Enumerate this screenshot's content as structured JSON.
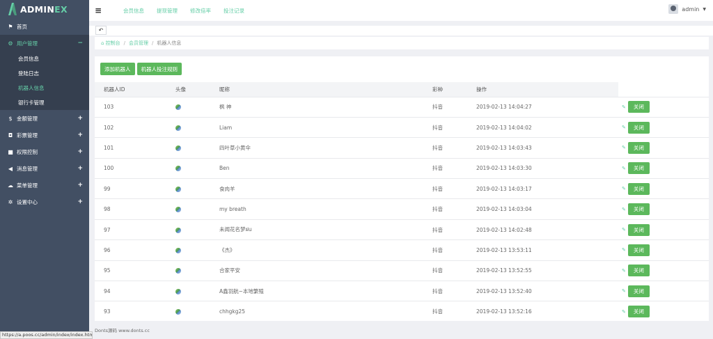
{
  "brand": {
    "main": "ADMIN",
    "accent": "EX",
    "color": "#65cea7"
  },
  "sidebar": {
    "items": [
      {
        "label": "首页",
        "icon": "flag-icon",
        "plus": ""
      },
      {
        "label": "用户管理",
        "icon": "circle-gear-icon",
        "plus": "−",
        "active": true,
        "children": [
          {
            "label": "会员信息"
          },
          {
            "label": "登陆日志"
          },
          {
            "label": "机器人信息",
            "active": true
          },
          {
            "label": "银行卡管理"
          }
        ]
      },
      {
        "label": "金额管理",
        "icon": "dollar-icon",
        "plus": "+"
      },
      {
        "label": "彩票管理",
        "icon": "shield-icon",
        "plus": "+"
      },
      {
        "label": "权限控制",
        "icon": "lock-icon",
        "plus": "+"
      },
      {
        "label": "消息管理",
        "icon": "bullhorn-icon",
        "plus": "+"
      },
      {
        "label": "菜单管理",
        "icon": "cloud-icon",
        "plus": "+"
      },
      {
        "label": "设置中心",
        "icon": "gear-icon",
        "plus": "+"
      }
    ]
  },
  "header": {
    "toggle": "≡",
    "links": [
      "会员信息",
      "提现管理",
      "修改倍率",
      "投注记录"
    ],
    "user": "admin"
  },
  "breadcrumb": {
    "home": "控制台",
    "section": "会员管理",
    "current": "机器人信息"
  },
  "toolbar": {
    "add_robot": "添加机器人",
    "robot_rules": "机器人投注规则"
  },
  "table": {
    "headers": [
      "机器人ID",
      "头像",
      "昵称",
      "彩种",
      "操作"
    ],
    "close_label": "关闭",
    "rows": [
      {
        "id": "103",
        "nick": "枫 神",
        "lottery": "抖音",
        "time": "2019-02-13 14:04:27"
      },
      {
        "id": "102",
        "nick": "Liam",
        "lottery": "抖音",
        "time": "2019-02-13 14:04:02"
      },
      {
        "id": "101",
        "nick": "四叶草小黄伞",
        "lottery": "抖音",
        "time": "2019-02-13 14:03:43"
      },
      {
        "id": "100",
        "nick": "Ben",
        "lottery": "抖音",
        "time": "2019-02-13 14:03:30"
      },
      {
        "id": "99",
        "nick": "食肉羊",
        "lottery": "抖音",
        "time": "2019-02-13 14:03:17"
      },
      {
        "id": "98",
        "nick": "my breath",
        "lottery": "抖音",
        "time": "2019-02-13 14:03:04"
      },
      {
        "id": "97",
        "nick": "未闻花名梦ฝu",
        "lottery": "抖音",
        "time": "2019-02-13 14:02:48"
      },
      {
        "id": "96",
        "nick": "《杰》",
        "lottery": "抖音",
        "time": "2019-02-13 13:53:11"
      },
      {
        "id": "95",
        "nick": "合家平安",
        "lottery": "抖音",
        "time": "2019-02-13 13:52:55"
      },
      {
        "id": "94",
        "nick": "A鑫羽航~本地繁殖",
        "lottery": "抖音",
        "time": "2019-02-13 13:52:40"
      },
      {
        "id": "93",
        "nick": "chhgkg25",
        "lottery": "抖音",
        "time": "2019-02-13 13:52:16"
      }
    ]
  },
  "footer": "Donts源码 www.donts.cc",
  "statusbar": "https://a.poos.cc/admin/index/index.html"
}
